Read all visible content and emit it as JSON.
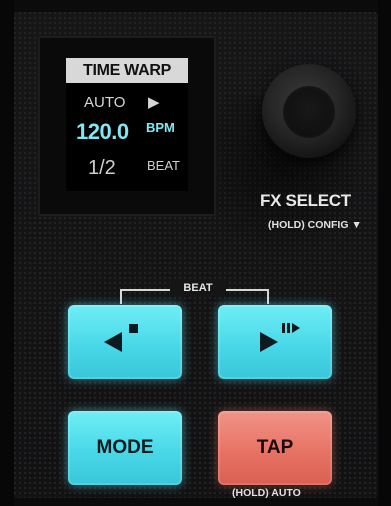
{
  "screen": {
    "title": "TIME WARP",
    "mode": "AUTO",
    "bpm_value": "120.0",
    "bpm_unit": "BPM",
    "beat_fraction": "1/2",
    "beat_label": "BEAT"
  },
  "encoder": {
    "label": "FX SELECT",
    "sublabel": "(HOLD) CONFIG ▼"
  },
  "beat_group": {
    "label": "BEAT"
  },
  "buttons": {
    "mode": "MODE",
    "tap": "TAP",
    "tap_sublabel": "(HOLD) AUTO"
  },
  "colors": {
    "screen_accent": "#7fe8f2",
    "button_cyan": "#49d8e8",
    "button_red": "#e77365"
  },
  "icons": {
    "play": "play-icon",
    "beat_back": "beat-jump-back-icon",
    "beat_forward": "beat-jump-forward-icon"
  }
}
